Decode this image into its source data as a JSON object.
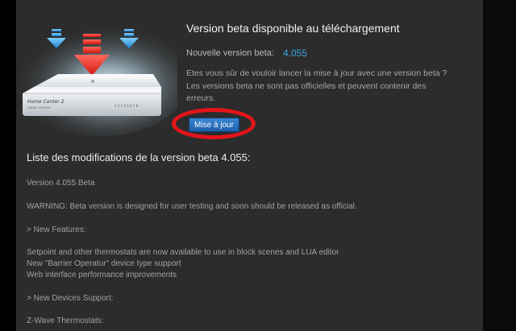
{
  "header": {
    "title": "Version beta disponible au téléchargement",
    "new_version_label": "Nouvelle version beta:",
    "new_version_value": "4.055",
    "confirm_lines": [
      "Etes vous sûr de vouloir lancer la mise à jour avec une version beta ?",
      "Les versions beta ne sont pas officielles et peuvent contenir des",
      "erreurs."
    ],
    "update_button_label": "Mise à jour"
  },
  "device": {
    "brand_line1": "Home Center 2",
    "brand_line2": "FIBARO SYSTEM",
    "ports_label": "1 2 3 4 5 6 7 8"
  },
  "changelog": {
    "title": "Liste des modifications de la version beta 4.055:",
    "lines": [
      "Version 4.055 Beta",
      "WARNING: Beta version is designed for user testing and soon should be released as official.",
      "> New Features:",
      "Setpoint and other thermostats are now available to use in block scenes and LUA editor",
      "New \"Barrier Operator\" device type support",
      "Web interface performance improvements",
      "> New Devices Support:",
      "Z-Wave Thermostats:"
    ]
  },
  "colors": {
    "panel_bg": "#2c2c2c",
    "accent_blue": "#39a8e4",
    "button_blue": "#2a72c0",
    "highlight_red": "#e3141b"
  }
}
